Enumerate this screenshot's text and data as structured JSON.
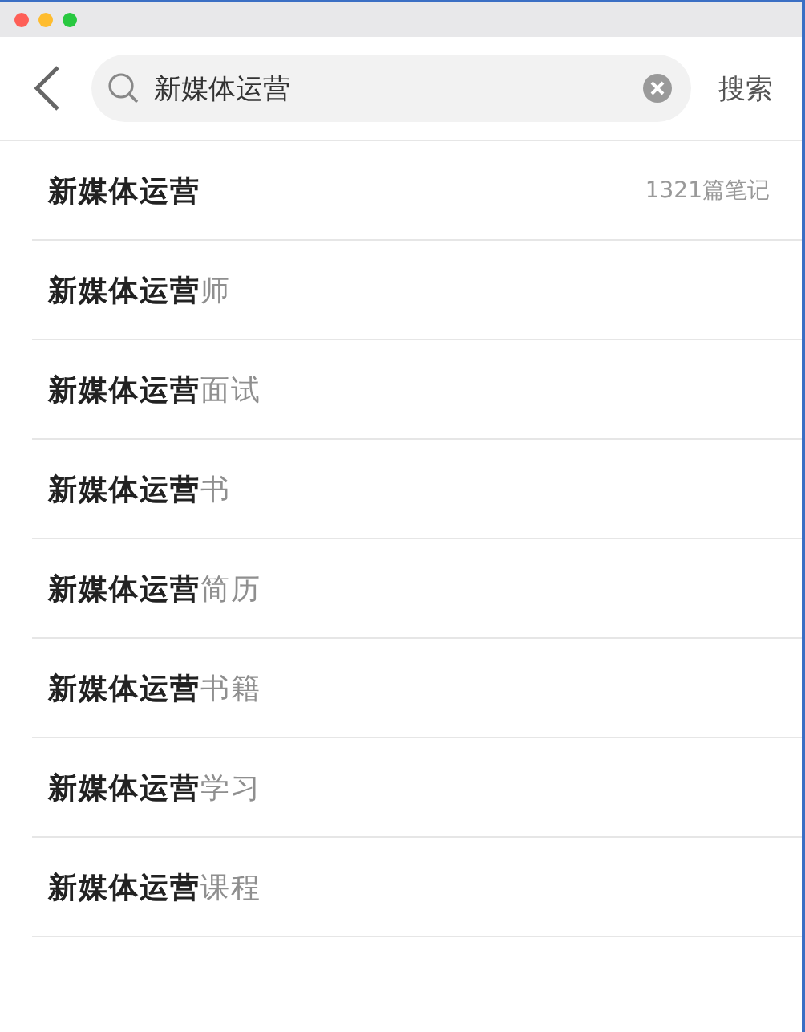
{
  "window": {
    "controls": [
      {
        "color": "#fe5f57"
      },
      {
        "color": "#febc2e"
      },
      {
        "color": "#28c840"
      }
    ]
  },
  "search": {
    "value": "新媒体运营",
    "action": "搜索"
  },
  "suggestions": [
    {
      "text": "**新媒体运营**",
      "count": "1321篇笔记"
    },
    {
      "text": "**新媒体运营**师"
    },
    {
      "text": "**新媒体运营**面试"
    },
    {
      "text": "**新媒体运营**书"
    },
    {
      "text": "**新媒体运营**简历"
    },
    {
      "text": "**新媒体运营**书籍"
    },
    {
      "text": "**新媒体运营**学习"
    },
    {
      "text": "**新媒体运营**课程"
    }
  ]
}
